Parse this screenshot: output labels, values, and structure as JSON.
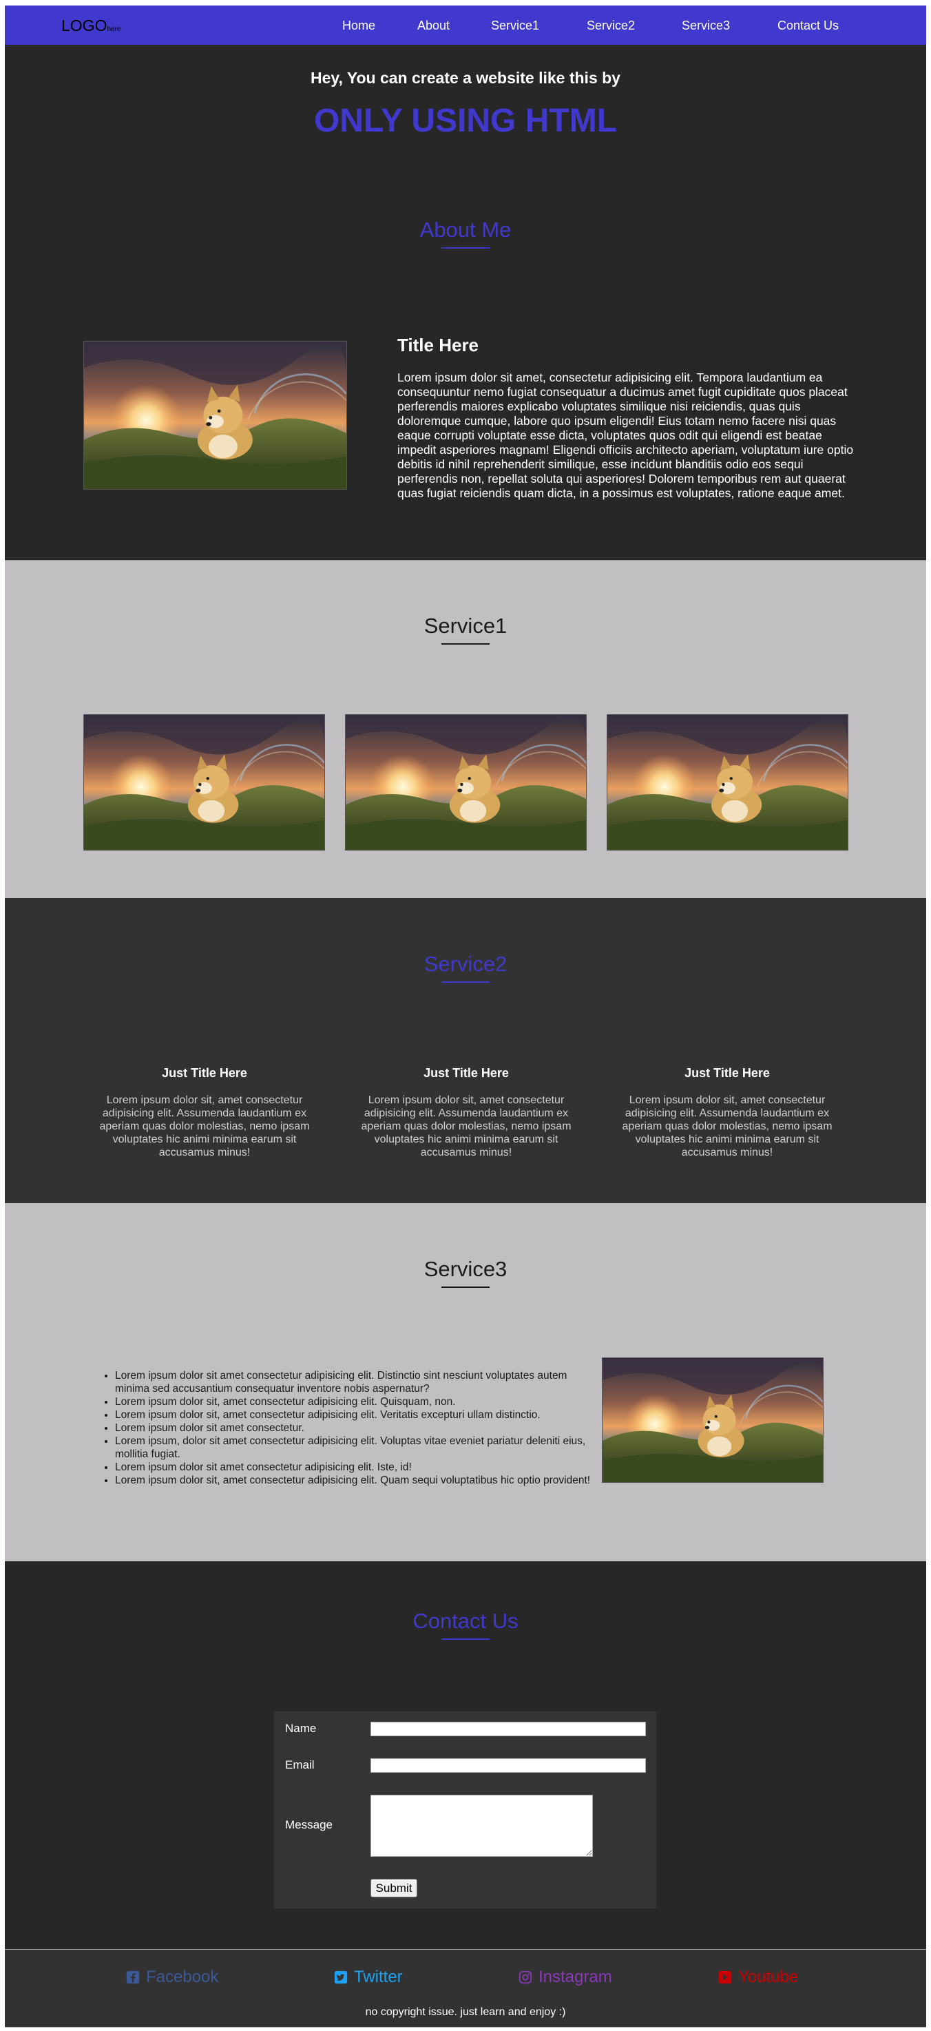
{
  "nav": {
    "logo": "LOGO",
    "logo_small": "here",
    "links": [
      "Home",
      "About",
      "Service1",
      "Service2",
      "Service3",
      "Contact Us"
    ]
  },
  "hero": {
    "line": "Hey, You can create a website like this by",
    "headline": "ONLY USING HTML"
  },
  "about": {
    "section_title": "About Me",
    "title": "Title Here",
    "text": "Lorem ipsum dolor sit amet, consectetur adipisicing elit. Tempora laudantium ea consequuntur nemo fugiat consequatur a ducimus amet fugit cupiditate quos placeat perferendis maiores explicabo voluptates similique nisi reiciendis, quas quis doloremque cumque, labore quo ipsum eligendi! Eius totam nemo facere nisi quas eaque corrupti voluptate esse dicta, voluptates quos odit qui eligendi est beatae impedit asperiores magnam! Eligendi officiis architecto aperiam, voluptatum iure optio debitis id nihil reprehenderit similique, esse incidunt blanditiis odio eos sequi perferendis non, repellat soluta qui asperiores! Dolorem temporibus rem aut quaerat quas fugiat reiciendis quam dicta, in a possimus est voluptates, ratione eaque amet."
  },
  "service1": {
    "section_title": "Service1"
  },
  "service2": {
    "section_title": "Service2",
    "cards": [
      {
        "title": "Just Title Here",
        "text": "Lorem ipsum dolor sit, amet consectetur adipisicing elit. Assumenda laudantium ex aperiam quas dolor molestias, nemo ipsam voluptates hic animi minima earum sit accusamus minus!"
      },
      {
        "title": "Just Title Here",
        "text": "Lorem ipsum dolor sit, amet consectetur adipisicing elit. Assumenda laudantium ex aperiam quas dolor molestias, nemo ipsam voluptates hic animi minima earum sit accusamus minus!"
      },
      {
        "title": "Just Title Here",
        "text": "Lorem ipsum dolor sit, amet consectetur adipisicing elit. Assumenda laudantium ex aperiam quas dolor molestias, nemo ipsam voluptates hic animi minima earum sit accusamus minus!"
      }
    ]
  },
  "service3": {
    "section_title": "Service3",
    "items": [
      "Lorem ipsum dolor sit amet consectetur adipisicing elit. Distinctio sint nesciunt voluptates autem minima sed accusantium consequatur inventore nobis aspernatur?",
      "Lorem ipsum dolor sit, amet consectetur adipisicing elit. Quisquam, non.",
      "Lorem ipsum dolor sit, amet consectetur adipisicing elit. Veritatis excepturi ullam distinctio.",
      "Lorem ipsum dolor sit amet consectetur.",
      "Lorem ipsum, dolor sit amet consectetur adipisicing elit. Voluptas vitae eveniet pariatur deleniti eius, mollitia fugiat.",
      "Lorem ipsum dolor sit amet consectetur adipisicing elit. Iste, id!",
      "Lorem ipsum dolor sit, amet consectetur adipisicing elit. Quam sequi voluptatibus hic optio provident!"
    ]
  },
  "contact": {
    "section_title": "Contact Us",
    "name_label": "Name",
    "email_label": "Email",
    "message_label": "Message",
    "name_value": "",
    "email_value": "",
    "message_value": "",
    "submit_label": "Submit"
  },
  "footer": {
    "facebook": "Facebook",
    "twitter": "Twitter",
    "instagram": "Instagram",
    "youtube": "Youtube",
    "copyright": "no copyright issue. just learn and enjoy :)"
  },
  "colors": {
    "accent": "#4139cd",
    "dark_bg": "#272727",
    "mid_bg": "#323232",
    "light_bg": "#c1bfc2",
    "facebook": "#3b5998",
    "twitter": "#1da1f2",
    "instagram": "#8a3ab9",
    "youtube": "#cc0000"
  }
}
